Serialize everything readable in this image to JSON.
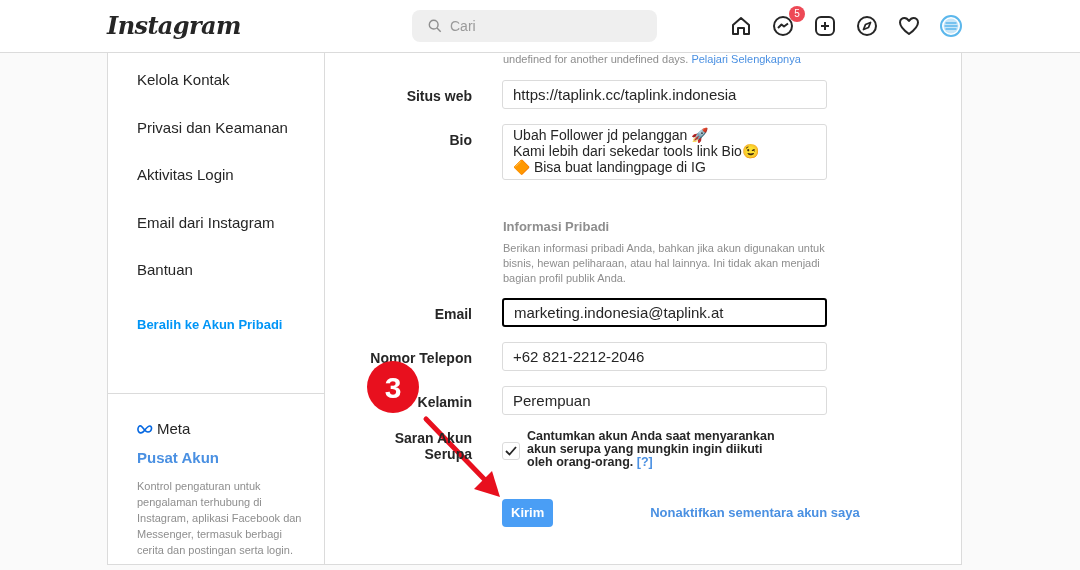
{
  "header": {
    "logo": "Instagram",
    "search": {
      "placeholder": "Cari"
    },
    "nav": [
      {
        "kind": "home"
      },
      {
        "kind": "messenger",
        "badge": "5"
      },
      {
        "kind": "add"
      },
      {
        "kind": "explore"
      },
      {
        "kind": "heart"
      },
      {
        "kind": "profile",
        "selected": true
      }
    ]
  },
  "sidebar": {
    "items": [
      {
        "label": "Kelola Kontak",
        "kind": "plain"
      },
      {
        "label": "Privasi dan Keamanan",
        "kind": "plain"
      },
      {
        "label": "Aktivitas Login",
        "kind": "plain"
      },
      {
        "label": "Email dari Instagram",
        "kind": "plain"
      },
      {
        "label": "Bantuan",
        "kind": "plain"
      },
      {
        "label": "Beralih ke Akun Pribadi",
        "kind": "link"
      }
    ],
    "accounts_center": {
      "brand": "Meta",
      "title": "Pusat Akun",
      "description": "Kontrol pengaturan untuk pengalaman terhubung di Instagram, aplikasi Facebook dan Messenger, termasuk berbagi cerita dan postingan serta login."
    }
  },
  "form": {
    "note": "undefined for another undefined days.",
    "note_link": "Pelajari Selengkapnya",
    "fields": [
      {
        "label": "Situs web",
        "value": "https://taplink.cc/taplink.indonesia",
        "kind": "input",
        "focused": false
      },
      {
        "label": "Bio",
        "value": "Ubah Follower jd pelanggan 🚀\nKami lebih dari sekedar tools link Bio😉\n🔶 Bisa buat landingpage di IG",
        "kind": "textarea",
        "focused": false
      },
      {
        "kind": "section",
        "title": "Informasi Pribadi",
        "description": "Berikan informasi pribadi Anda, bahkan jika akun digunakan untuk bisnis, hewan peliharaan, atau hal lainnya. Ini tidak akan menjadi bagian profil publik Anda."
      },
      {
        "label": "Email",
        "value": "marketing.indonesia@taplink.at",
        "kind": "input",
        "focused": true
      },
      {
        "label": "Nomor Telepon",
        "value": "+62 821-2212-2046",
        "kind": "input",
        "focused": false
      },
      {
        "label": "Kelamin",
        "value": "Perempuan",
        "kind": "input",
        "focused": false
      },
      {
        "label": "Saran Akun Serupa",
        "kind": "checkbox",
        "checked": true,
        "text": "Cantumkan akun Anda saat menyarankan akun serupa yang mungkin ingin diikuti oleh orang-orang.",
        "help": "[?]"
      }
    ],
    "submit": "Kirim",
    "deactivate": "Nonaktifkan sementara akun saya"
  },
  "annotation": {
    "step": "3"
  }
}
